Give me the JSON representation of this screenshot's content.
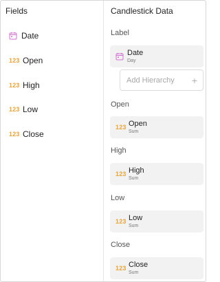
{
  "fields_panel": {
    "title": "Fields",
    "items": [
      {
        "label": "Date",
        "icon": "calendar-icon",
        "icon_text": ""
      },
      {
        "label": "Open",
        "icon": "numeric-icon",
        "icon_text": "123"
      },
      {
        "label": "High",
        "icon": "numeric-icon",
        "icon_text": "123"
      },
      {
        "label": "Low",
        "icon": "numeric-icon",
        "icon_text": "123"
      },
      {
        "label": "Close",
        "icon": "numeric-icon",
        "icon_text": "123"
      }
    ]
  },
  "data_panel": {
    "title": "Candlestick Data",
    "sections": {
      "label": {
        "title": "Label",
        "slot_name": "Date",
        "slot_sub": "Day"
      },
      "open": {
        "title": "Open",
        "slot_name": "Open",
        "slot_sub": "Sum",
        "icon_text": "123"
      },
      "high": {
        "title": "High",
        "slot_name": "High",
        "slot_sub": "Sum",
        "icon_text": "123"
      },
      "low": {
        "title": "Low",
        "slot_name": "Low",
        "slot_sub": "Sum",
        "icon_text": "123"
      },
      "close": {
        "title": "Close",
        "slot_name": "Close",
        "slot_sub": "Sum",
        "icon_text": "123"
      }
    },
    "add_hierarchy": {
      "placeholder": "Add Hierarchy",
      "plus": "+"
    }
  },
  "colors": {
    "numeric_icon": "#e8a33a",
    "date_icon": "#d16fd1",
    "slot_background": "#f2f2f2"
  }
}
